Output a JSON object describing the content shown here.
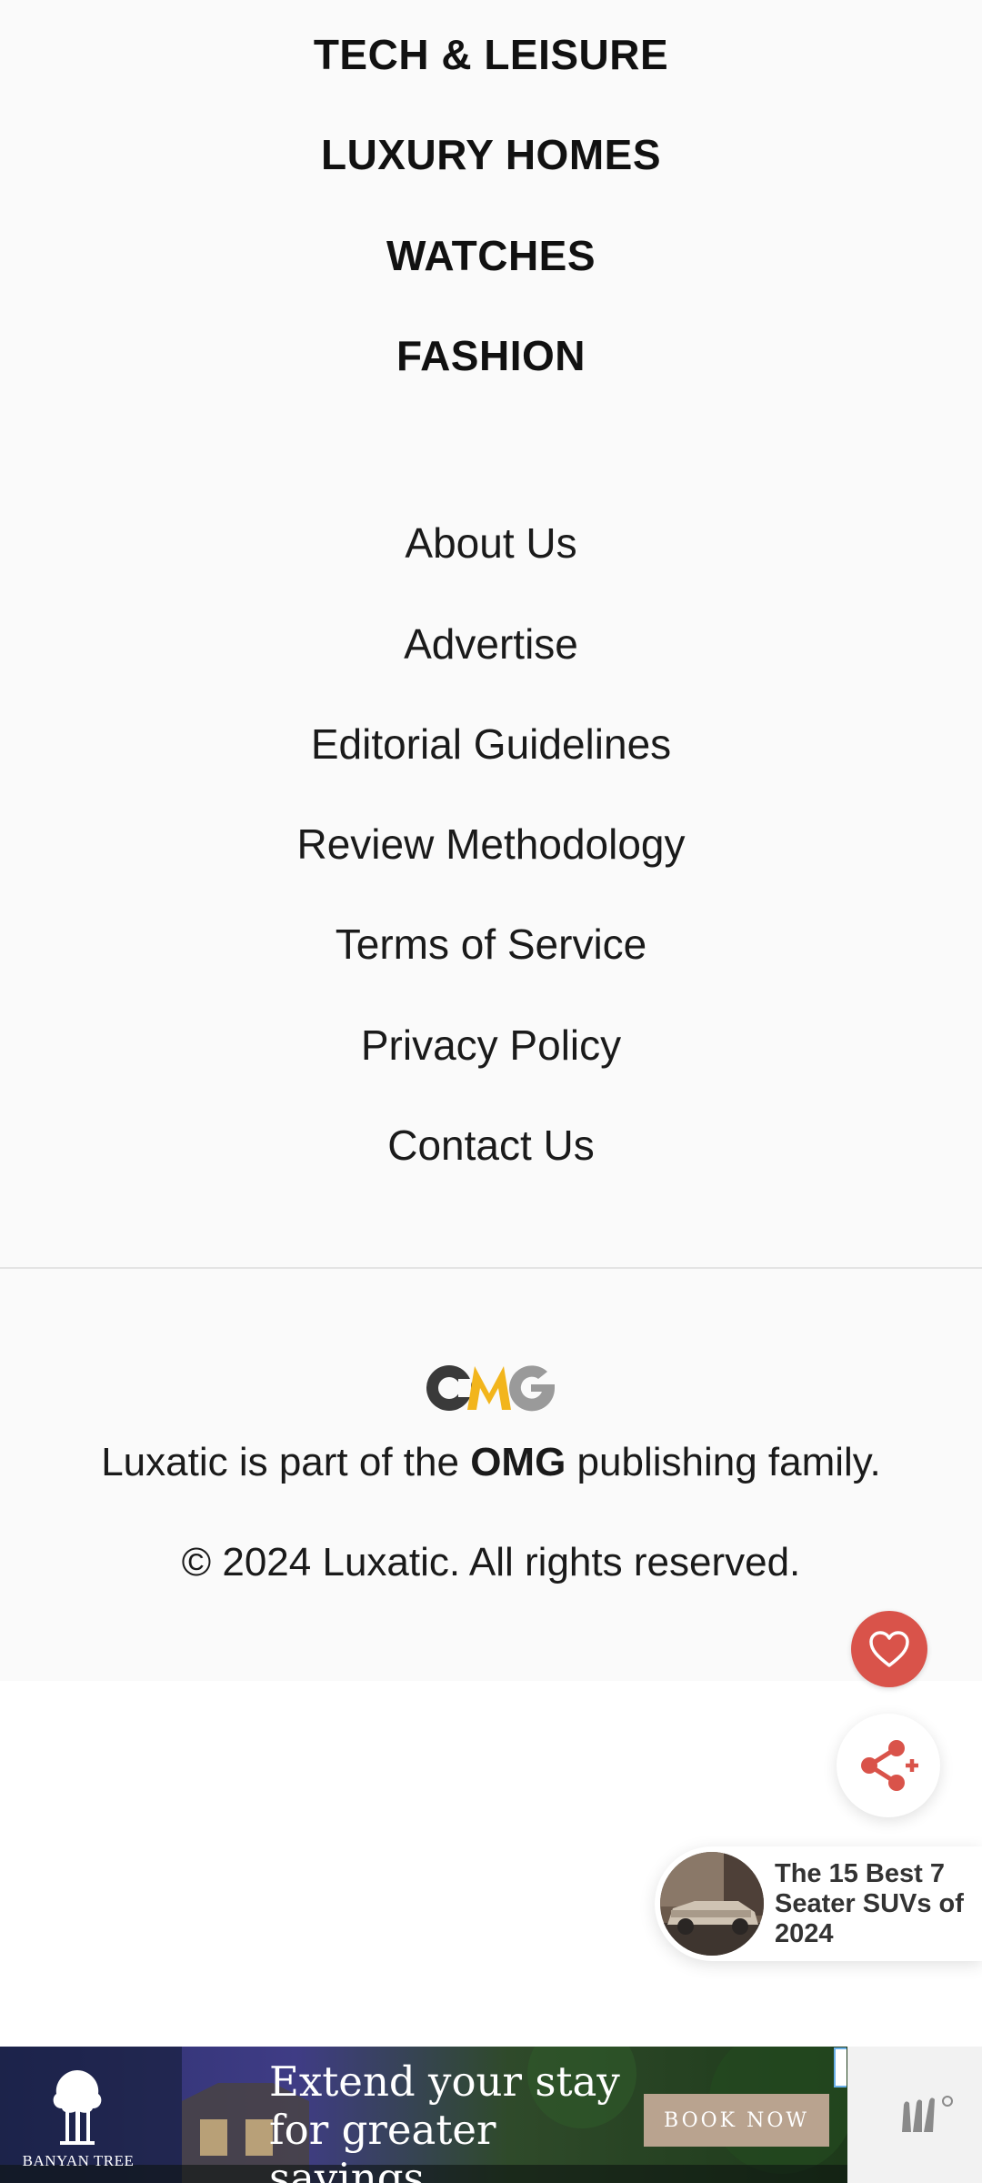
{
  "categories": [
    {
      "label": "TECH & LEISURE"
    },
    {
      "label": "LUXURY HOMES"
    },
    {
      "label": "WATCHES"
    },
    {
      "label": "FASHION"
    }
  ],
  "footer_links": [
    {
      "label": "About Us"
    },
    {
      "label": "Advertise"
    },
    {
      "label": "Editorial Guidelines"
    },
    {
      "label": "Review Methodology"
    },
    {
      "label": "Terms of Service"
    },
    {
      "label": "Privacy Policy"
    },
    {
      "label": "Contact Us"
    }
  ],
  "publisher": {
    "logo_text": "OMG",
    "family_prefix": "Luxatic is part of the ",
    "family_brand": "OMG",
    "family_suffix": " publishing family.",
    "copyright": "© 2024 Luxatic. All rights reserved."
  },
  "floating_actions": {
    "favorite_icon": "heart-icon",
    "share_icon": "share-icon"
  },
  "promo": {
    "title": "The 15 Best 7 Seater SUVs of 2024"
  },
  "ad": {
    "brand": "BANYAN TREE",
    "headline_line1": "Extend your stay",
    "headline_line2": "for greater savings",
    "cta": "BOOK NOW"
  },
  "colors": {
    "accent_red": "#d9534a",
    "omg_yellow": "#f2b51c",
    "footer_bg": "#fafafa"
  }
}
